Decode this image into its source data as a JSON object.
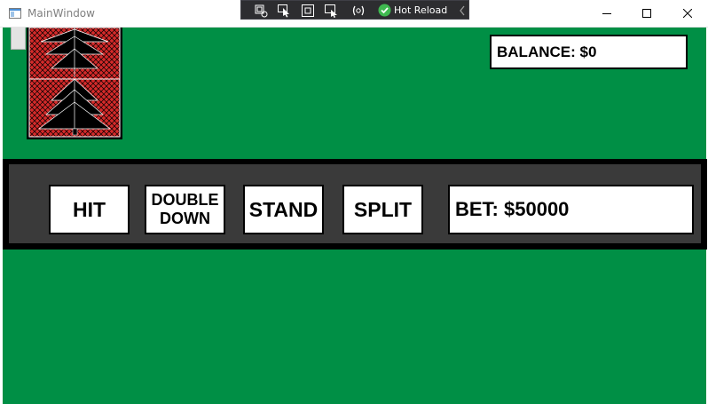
{
  "window": {
    "title": "MainWindow",
    "controls": [
      "minimize",
      "maximize",
      "close"
    ]
  },
  "debug_toolbar": {
    "icons": [
      "select-element-icon",
      "pointer-icon",
      "layout-adorner-icon",
      "track-focus-icon",
      "binding-failures-icon"
    ],
    "hot_reload_label": "Hot Reload",
    "hot_reload_status_color": "#3fb950"
  },
  "table": {
    "felt_color": "#008f45",
    "card_back_colors": {
      "pattern": "#d42a2a",
      "tree": "#000000",
      "lines": "#ffffff"
    }
  },
  "balance": {
    "text": "BALANCE: $0"
  },
  "actions": {
    "hit": "HIT",
    "double_line1": "DOUBLE",
    "double_line2": "DOWN",
    "stand": "STAND",
    "split": "SPLIT"
  },
  "bet": {
    "text": "BET: $50000"
  }
}
